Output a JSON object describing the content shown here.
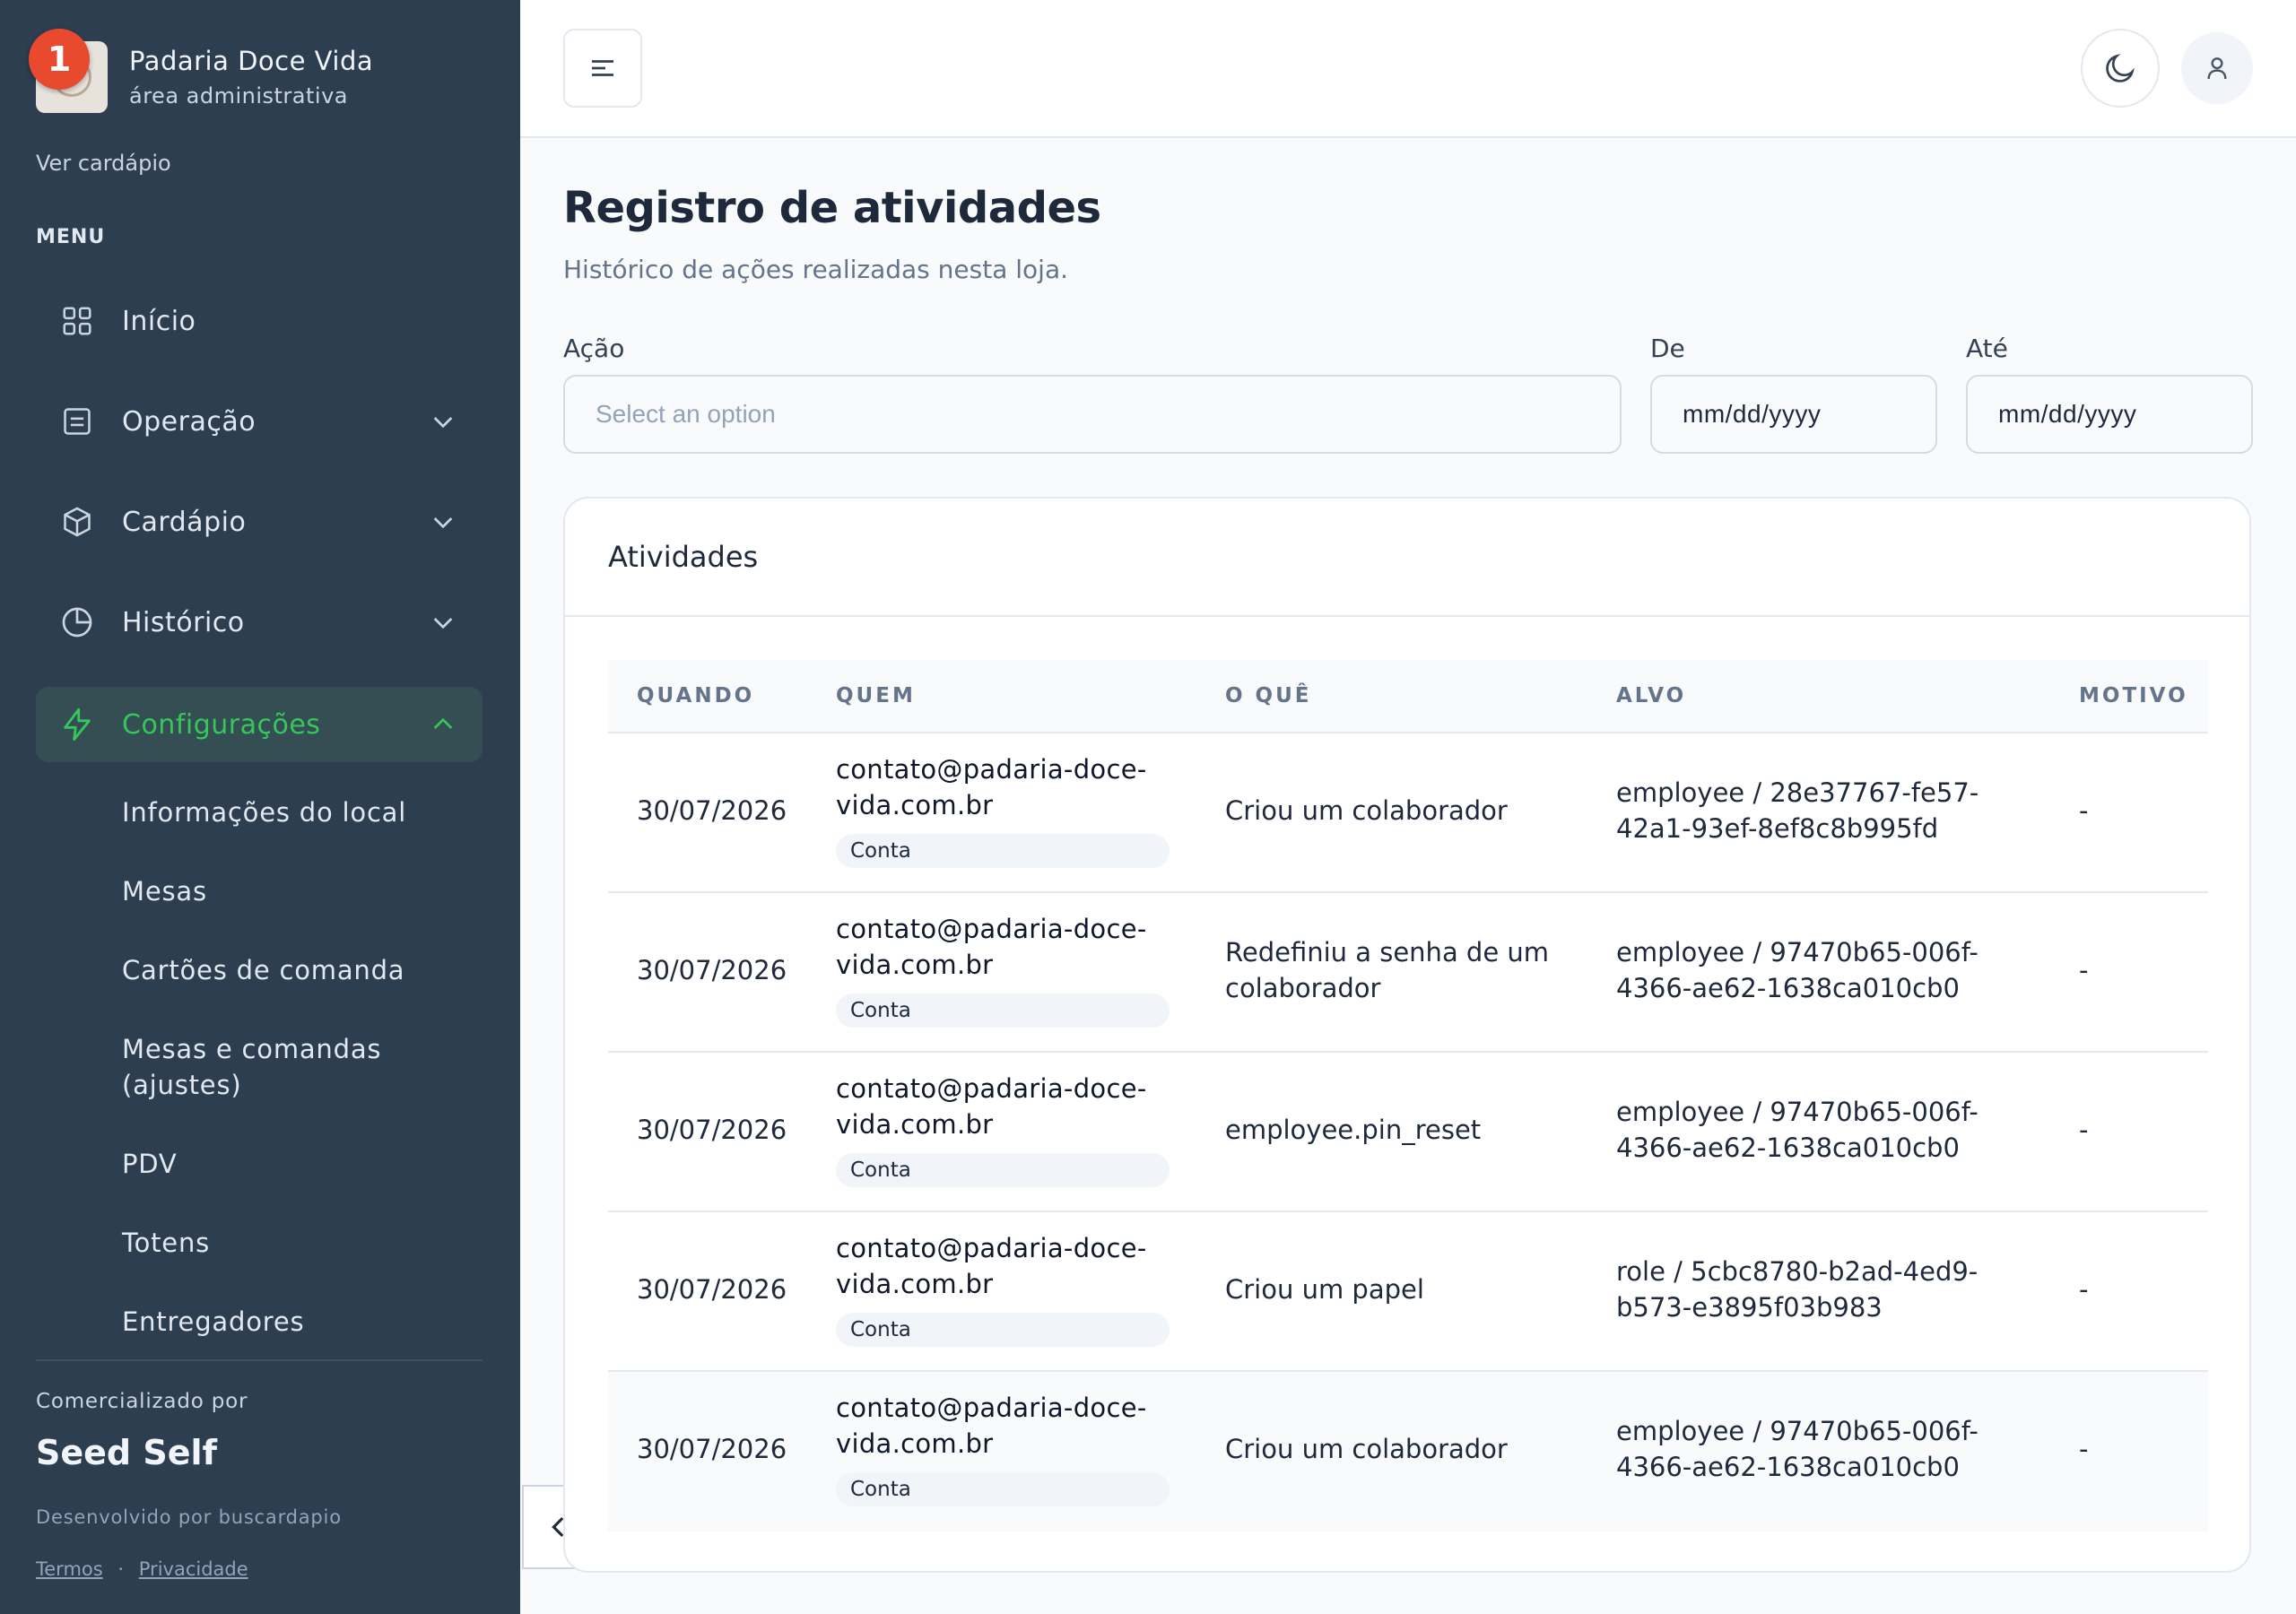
{
  "sidebar": {
    "notification_count": "1",
    "brand_name": "Padaria Doce Vida",
    "brand_sub": "área administrativa",
    "view_menu": "Ver cardápio",
    "menu_label": "MENU",
    "items": [
      {
        "label": "Início",
        "icon": "grid-icon"
      },
      {
        "label": "Operação",
        "icon": "clipboard-icon"
      },
      {
        "label": "Cardápio",
        "icon": "box-icon"
      },
      {
        "label": "Histórico",
        "icon": "pie-chart-icon"
      },
      {
        "label": "Configurações",
        "icon": "lightning-icon"
      }
    ],
    "subitems": [
      "Informações do local",
      "Mesas",
      "Cartões de comanda",
      "Mesas e comandas (ajustes)",
      "PDV",
      "Totens",
      "Entregadores"
    ],
    "commercial_by": "Comercializado por",
    "brand_footer": "Seed Self",
    "developed_by": "Desenvolvido por buscardapio",
    "terms": "Termos",
    "separator": "·",
    "privacy": "Privacidade",
    "active_color": "#34c759"
  },
  "page": {
    "title": "Registro de atividades",
    "subtitle": "Histórico de ações realizadas nesta loja."
  },
  "filters": {
    "action_label": "Ação",
    "action_placeholder": "Select an option",
    "from_label": "De",
    "from_value": "mm/dd/yyyy",
    "to_label": "Até",
    "to_value": "mm/dd/yyyy"
  },
  "card": {
    "title": "Atividades",
    "columns": [
      "QUANDO",
      "QUEM",
      "O QUÊ",
      "ALVO",
      "MOTIVO"
    ],
    "rows": [
      {
        "when": "30/07/2026",
        "who": "contato@padaria-doce-vida.com.br",
        "who_badge": "Conta",
        "what": "Criou um colaborador",
        "target": "employee / 28e37767-fe57-42a1-93ef-8ef8c8b995fd",
        "reason": "-"
      },
      {
        "when": "30/07/2026",
        "who": "contato@padaria-doce-vida.com.br",
        "who_badge": "Conta",
        "what": "Redefiniu a senha de um colaborador",
        "target": "employee / 97470b65-006f-4366-ae62-1638ca010cb0",
        "reason": "-"
      },
      {
        "when": "30/07/2026",
        "who": "contato@padaria-doce-vida.com.br",
        "who_badge": "Conta",
        "what": "employee.pin_reset",
        "target": "employee / 97470b65-006f-4366-ae62-1638ca010cb0",
        "reason": "-"
      },
      {
        "when": "30/07/2026",
        "who": "contato@padaria-doce-vida.com.br",
        "who_badge": "Conta",
        "what": "Criou um papel",
        "target": "role / 5cbc8780-b2ad-4ed9-b573-e3895f03b983",
        "reason": "-"
      },
      {
        "when": "30/07/2026",
        "who": "contato@padaria-doce-vida.com.br",
        "who_badge": "Conta",
        "what": "Criou um colaborador",
        "target": "employee / 97470b65-006f-4366-ae62-1638ca010cb0",
        "reason": "-"
      }
    ]
  }
}
